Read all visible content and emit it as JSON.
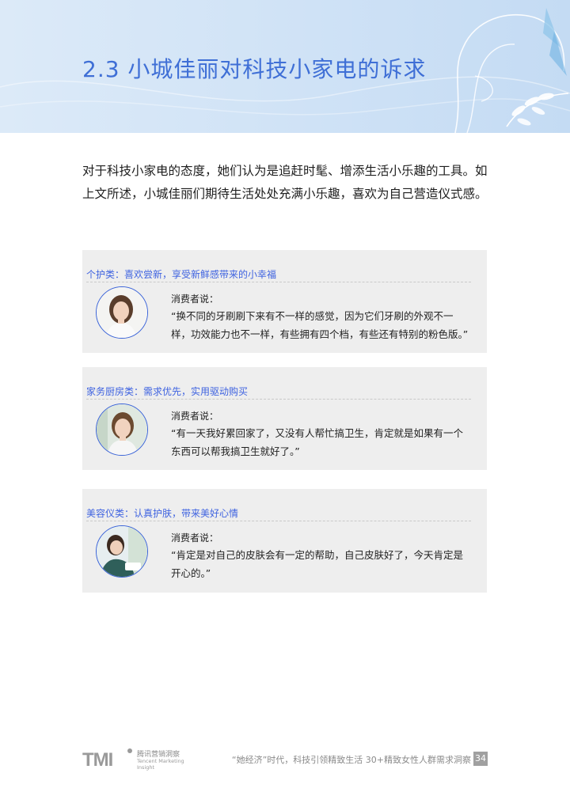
{
  "header": {
    "title": "2.3 小城佳丽对科技小家电的诉求"
  },
  "intro": {
    "text": "对于科技小家电的态度，她们认为是追赶时髦、增添生活小乐趣的工具。如上文所述，小城佳丽们期待生活处处充满小乐趣，喜欢为自己营造仪式感。"
  },
  "cards": [
    {
      "category": "个护类：喜欢尝新，享受新鲜感带来的小幸福",
      "speaker_label": "消费者说：",
      "quote": "“换不同的牙刷刷下来有不一样的感觉，因为它们牙刷的外观不一样，功效能力也不一样，有些拥有四个档，有些还有特别的粉色版。”"
    },
    {
      "category": "家务厨房类：需求优先，实用驱动购买",
      "speaker_label": "消费者说：",
      "quote": "“有一天我好累回家了，又没有人帮忙搞卫生，肯定就是如果有一个东西可以帮我搞卫生就好了。”"
    },
    {
      "category": "美容仪类：认真护肤，带来美好心情",
      "speaker_label": "消费者说：",
      "quote": "“肯定是对自己的皮肤会有一定的帮助，自己皮肤好了，今天肯定是开心的。”"
    }
  ],
  "footer": {
    "logo_text": "TMI",
    "logo_cn": "腾讯营销洞察",
    "logo_en": "Tencent Marketing Insight",
    "report_title": "“她经济”时代，科技引领精致生活 30+精致女性人群需求洞察",
    "page_number": "34"
  },
  "colors": {
    "accent": "#3f6fd6",
    "banner": "#d2e4f6",
    "card_bg": "#eeeeee",
    "muted": "#8a8a8a"
  }
}
